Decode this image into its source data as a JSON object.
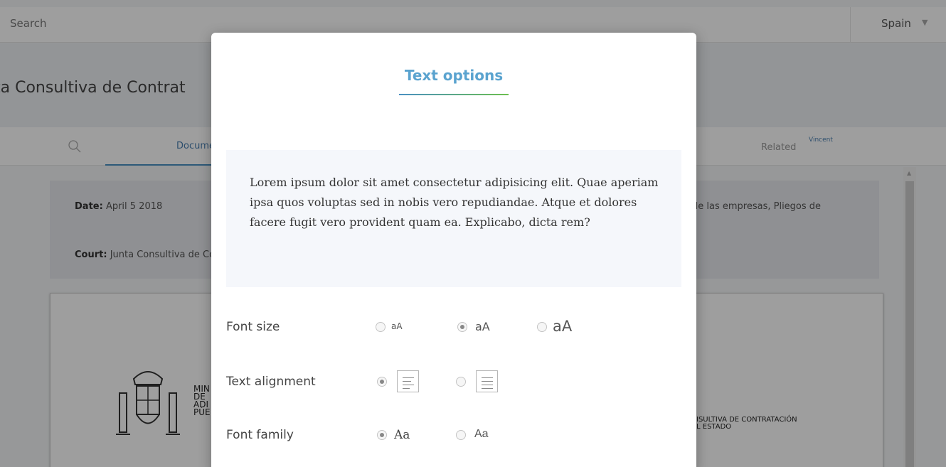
{
  "topbar": {
    "search_text": "Search",
    "country": "Spain"
  },
  "document": {
    "title": "ta Consultiva de Contrat"
  },
  "tabs": {
    "doc_label": "Documents",
    "related_label": "Related",
    "related_badge": "Vincent"
  },
  "info": {
    "date_key": "Date:",
    "date_value": "April 5 2018",
    "court_key": "Court:",
    "court_value": "Junta Consultiva de Contratación",
    "right_text": "de las empresas, Pliegos de"
  },
  "paper": {
    "ministry_lines": [
      "MIN",
      "DE",
      "ADI",
      "PÚE"
    ],
    "junta_lines": [
      "ISULTIVA DE CONTRATACIÓN",
      "L ESTADO"
    ]
  },
  "modal": {
    "title": "Text options",
    "preview_text": "Lorem ipsum dolor sit amet consectetur adipisicing elit. Quae aperiam ipsa quos voluptas sed in nobis vero repudiandae. Atque et dolores facere fugit vero provident quam ea. Explicabo, dicta rem?",
    "font_size": {
      "label": "Font size",
      "options": [
        "aA",
        "aA",
        "aA"
      ],
      "selected_index": 1
    },
    "text_alignment": {
      "label": "Text alignment",
      "options": [
        "align-left-icon",
        "justify-icon"
      ],
      "selected_index": 0
    },
    "font_family": {
      "label": "Font family",
      "options": [
        "Aa",
        "Aa"
      ],
      "selected_index": 0
    }
  },
  "colors": {
    "accent": "#5aa3cf",
    "underline_end": "#6cbf4f"
  }
}
